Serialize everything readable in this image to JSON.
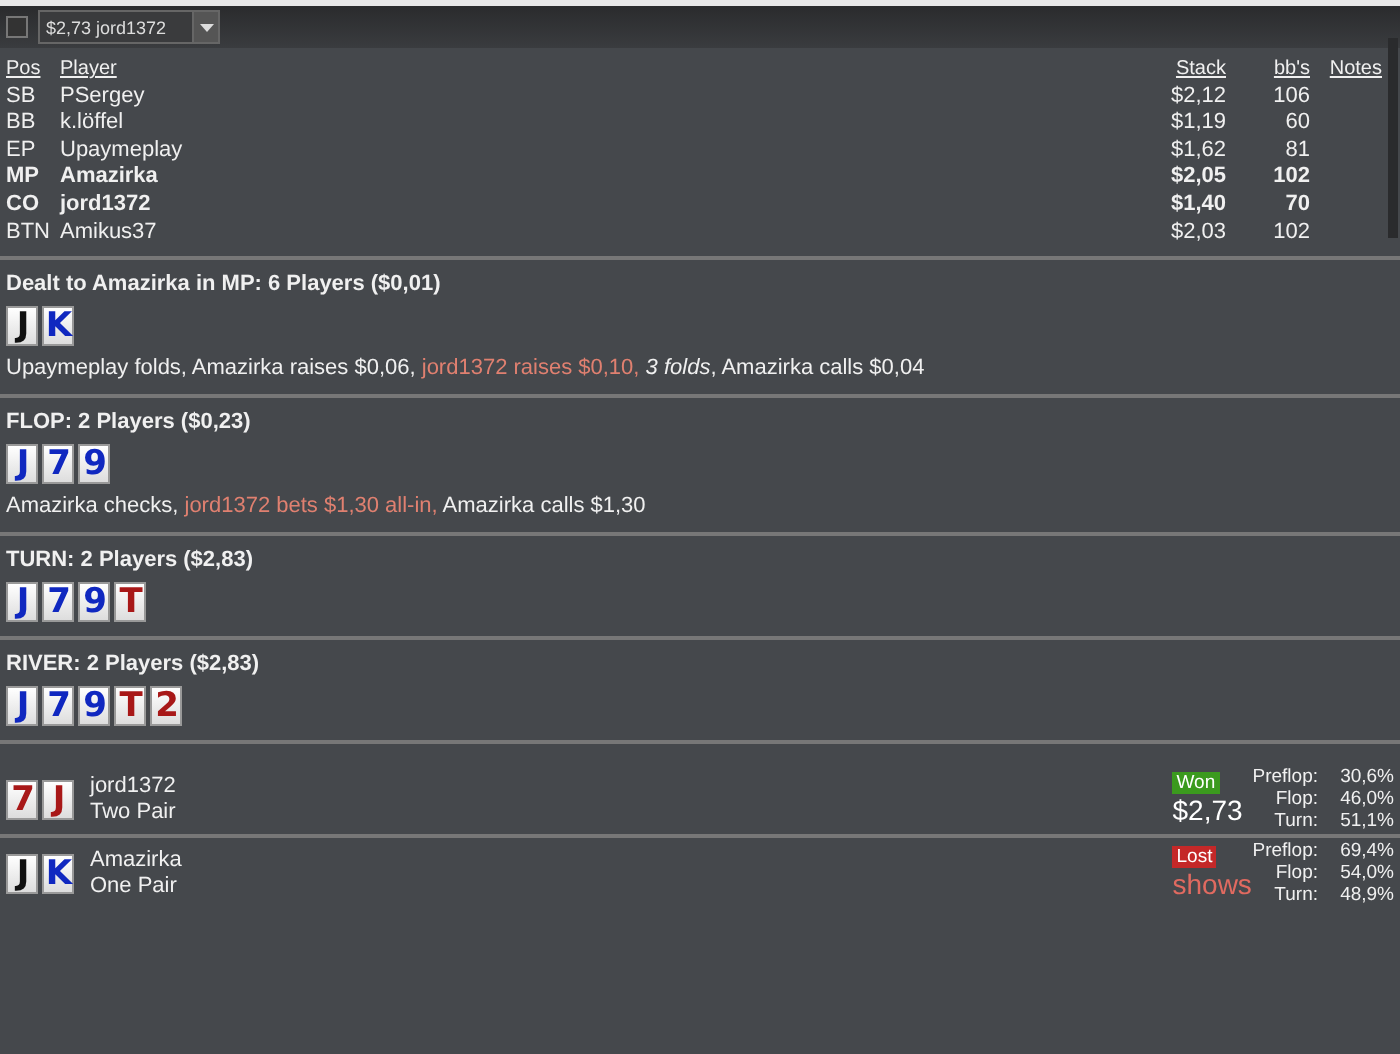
{
  "toolbar": {
    "checked": false,
    "hand_select": "$2,73 jord1372"
  },
  "players": {
    "columns": [
      "Pos",
      "Player",
      "Stack",
      "bb's",
      "Notes"
    ],
    "rows": [
      {
        "pos": "SB",
        "name": "PSergey",
        "stack": "$2,12",
        "bbs": "106",
        "bold": false
      },
      {
        "pos": "BB",
        "name": "k.löffel",
        "stack": "$1,19",
        "bbs": "60",
        "bold": false
      },
      {
        "pos": "EP",
        "name": "Upaymeplay",
        "stack": "$1,62",
        "bbs": "81",
        "bold": false
      },
      {
        "pos": "MP",
        "name": "Amazirka",
        "stack": "$2,05",
        "bbs": "102",
        "bold": true
      },
      {
        "pos": "CO",
        "name": "jord1372",
        "stack": "$1,40",
        "bbs": "70",
        "bold": true
      },
      {
        "pos": "BTN",
        "name": "Amikus37",
        "stack": "$2,03",
        "bbs": "102",
        "bold": false
      }
    ]
  },
  "streets": [
    {
      "title": "Dealt to Amazirka in MP: 6 Players ($0,01)",
      "cards": [
        {
          "rank": "J",
          "color": "#111111"
        },
        {
          "rank": "K",
          "color": "#1028c0"
        }
      ],
      "actions": [
        {
          "text": "Upaymeplay folds, Amazirka raises $0,06, ",
          "kind": "plain"
        },
        {
          "text": "jord1372 raises $0,10, ",
          "kind": "opponent"
        },
        {
          "text": "3 folds",
          "kind": "italic"
        },
        {
          "text": ", Amazirka calls $0,04",
          "kind": "plain"
        }
      ]
    },
    {
      "title": "FLOP: 2 Players ($0,23)",
      "cards": [
        {
          "rank": "J",
          "color": "#1028c0"
        },
        {
          "rank": "7",
          "color": "#1028c0"
        },
        {
          "rank": "9",
          "color": "#1028c0"
        }
      ],
      "actions": [
        {
          "text": "Amazirka checks, ",
          "kind": "plain"
        },
        {
          "text": "jord1372 bets $1,30 all-in, ",
          "kind": "opponent"
        },
        {
          "text": "Amazirka calls $1,30",
          "kind": "plain"
        }
      ]
    },
    {
      "title": "TURN: 2 Players ($2,83)",
      "cards": [
        {
          "rank": "J",
          "color": "#1028c0"
        },
        {
          "rank": "7",
          "color": "#1028c0"
        },
        {
          "rank": "9",
          "color": "#1028c0"
        },
        {
          "rank": "T",
          "color": "#a81818"
        }
      ]
    },
    {
      "title": "RIVER: 2 Players ($2,83)",
      "cards": [
        {
          "rank": "J",
          "color": "#1028c0"
        },
        {
          "rank": "7",
          "color": "#1028c0"
        },
        {
          "rank": "9",
          "color": "#1028c0"
        },
        {
          "rank": "T",
          "color": "#a81818"
        },
        {
          "rank": "2",
          "color": "#a81818"
        }
      ]
    }
  ],
  "results": [
    {
      "cards": [
        {
          "rank": "7",
          "color": "#a81818"
        },
        {
          "rank": "J",
          "color": "#a81818"
        }
      ],
      "name": "jord1372",
      "hand": "Two Pair",
      "kind": "winner",
      "badge": "Won",
      "amount": "$2,73",
      "equity": [
        {
          "street": "Preflop:",
          "value": "30,6%"
        },
        {
          "street": "Flop:",
          "value": "46,0%"
        },
        {
          "street": "Turn:",
          "value": "51,1%"
        }
      ]
    },
    {
      "cards": [
        {
          "rank": "J",
          "color": "#111111"
        },
        {
          "rank": "K",
          "color": "#1028c0"
        }
      ],
      "name": "Amazirka",
      "hand": "One Pair",
      "kind": "loser",
      "badge": "Lost",
      "amount": "shows",
      "equity": [
        {
          "street": "Preflop:",
          "value": "69,4%"
        },
        {
          "street": "Flop:",
          "value": "54,0%"
        },
        {
          "street": "Turn:",
          "value": "48,9%"
        }
      ]
    }
  ]
}
